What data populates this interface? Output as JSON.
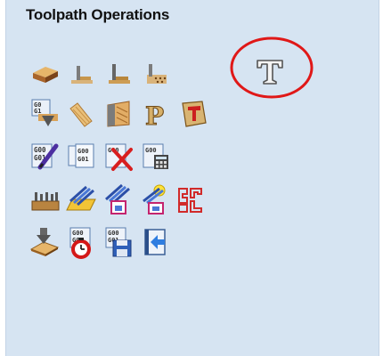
{
  "panel": {
    "title": "Toolpath Operations"
  },
  "icons": {
    "row1": [
      "wood-block-icon",
      "profile-toolpath-icon",
      "pocket-toolpath-icon",
      "drilling-toolpath-icon",
      "text-tool-icon"
    ],
    "row2": [
      "gcode-download-icon",
      "texture-toolpath-icon",
      "fluting-icon",
      "prism-carving-icon",
      "engraving-icon"
    ],
    "row3": [
      "edit-gcode-icon",
      "gcode-files-icon",
      "delete-toolpath-icon",
      "toolpath-calculator-icon"
    ],
    "row4": [
      "tabs-tool-icon",
      "layers-folder-icon",
      "layers-save-icon",
      "layers-light-icon",
      "nesting-icon"
    ],
    "row5": [
      "material-setup-icon",
      "gcode-timer-icon",
      "save-toolpath-icon",
      "import-toolpath-icon"
    ]
  },
  "colors": {
    "panel_bg": "#d6e4f2",
    "highlight_circle": "#e01818"
  }
}
